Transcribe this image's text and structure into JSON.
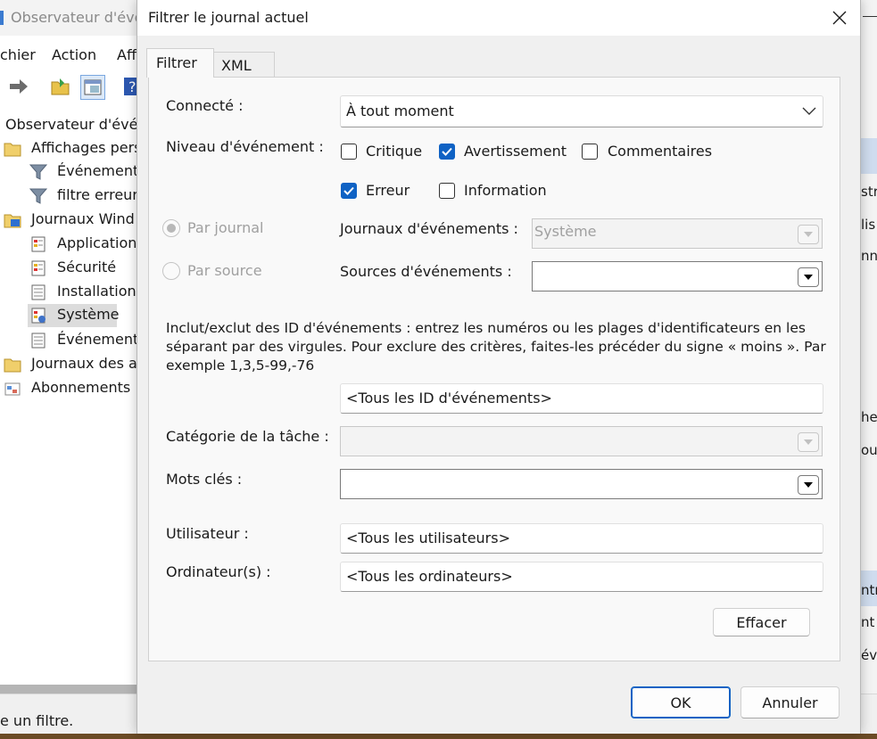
{
  "background_window": {
    "title": "Observateur d'évé",
    "menu": [
      "chier",
      "Action",
      "Aff"
    ],
    "tree": [
      {
        "label": "Observateur d'évé",
        "icon": "event-viewer-icon"
      },
      {
        "label": "Affichages pers",
        "icon": "folder-icon"
      },
      {
        "label": "Événements",
        "icon": "filter-icon"
      },
      {
        "label": "filtre erreur",
        "icon": "filter-icon"
      },
      {
        "label": "Journaux Wind",
        "icon": "windows-logs-icon"
      },
      {
        "label": "Application",
        "icon": "log-icon"
      },
      {
        "label": "Sécurité",
        "icon": "log-icon"
      },
      {
        "label": "Installation",
        "icon": "log-icon"
      },
      {
        "label": "Système",
        "icon": "log-icon"
      },
      {
        "label": "Événements",
        "icon": "log-icon"
      },
      {
        "label": "Journaux des a",
        "icon": "folder-icon"
      },
      {
        "label": "Abonnements",
        "icon": "subscriptions-icon"
      }
    ],
    "status_text": "e un filtre.",
    "right_fragments": [
      "str",
      "lis",
      "nn",
      "her",
      "ou",
      "ntre",
      "nt",
      "év"
    ]
  },
  "dialog": {
    "title": "Filtrer le journal actuel",
    "tabs": [
      {
        "label": "Filtrer",
        "active": true
      },
      {
        "label": "XML",
        "active": false
      }
    ],
    "connected_label": "Connecté :",
    "connected_value": "À tout moment",
    "level_label": "Niveau d'événement :",
    "levels": {
      "critical": {
        "label": "Critique",
        "checked": false
      },
      "warning": {
        "label": "Avertissement",
        "checked": true
      },
      "verbose": {
        "label": "Commentaires",
        "checked": false
      },
      "error": {
        "label": "Erreur",
        "checked": true
      },
      "information": {
        "label": "Information",
        "checked": false
      }
    },
    "by_log_label": "Par journal",
    "by_source_label": "Par source",
    "event_logs_label": "Journaux d'événements :",
    "event_logs_value": "Système",
    "event_sources_label": "Sources d'événements :",
    "event_sources_value": "",
    "description": "Inclut/exclut des ID d'événements : entrez les numéros ou les plages d'identificateurs en les séparant par des virgules. Pour exclure des critères, faites-les précéder du signe « moins ». Par exemple 1,3,5-99,-76",
    "event_ids_value": "<Tous les ID d'événements>",
    "task_category_label": "Catégorie de la tâche :",
    "task_category_value": "",
    "keywords_label": "Mots clés :",
    "keywords_value": "",
    "user_label": "Utilisateur :",
    "user_value": "<Tous les utilisateurs>",
    "computers_label": "Ordinateur(s) :",
    "computers_value": "<Tous les ordinateurs>",
    "clear_button": "Effacer",
    "ok_button": "OK",
    "cancel_button": "Annuler"
  },
  "colors": {
    "accent": "#0f62c4",
    "dialog_bg": "#f0f0f0",
    "panel_bg": "#f9f9f9"
  }
}
